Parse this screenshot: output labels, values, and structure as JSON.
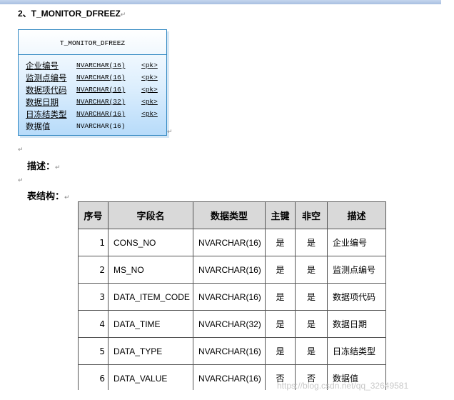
{
  "heading": "2、T_MONITOR_DFREEZ",
  "para_mark": "↵",
  "entity": {
    "title": "T_MONITOR_DFREEZ",
    "columns": [
      {
        "name": "企业编号",
        "type": "NVARCHAR(16)",
        "key": "<pk>"
      },
      {
        "name": "监测点编号",
        "type": "NVARCHAR(16)",
        "key": "<pk>"
      },
      {
        "name": "数据项代码",
        "type": "NVARCHAR(16)",
        "key": "<pk>"
      },
      {
        "name": "数据日期",
        "type": "NVARCHAR(32)",
        "key": "<pk>"
      },
      {
        "name": "日冻结类型",
        "type": "NVARCHAR(16)",
        "key": "<pk>"
      },
      {
        "name": "数据值",
        "type": "NVARCHAR(16)",
        "key": ""
      }
    ]
  },
  "desc_label": "描述：",
  "struct_label": "表结构：",
  "table": {
    "headers": [
      "序号",
      "字段名",
      "数据类型",
      "主键",
      "非空",
      "描述"
    ],
    "rows": [
      [
        "1",
        "CONS_NO",
        "NVARCHAR(16)",
        "是",
        "是",
        "企业编号"
      ],
      [
        "2",
        "MS_NO",
        "NVARCHAR(16)",
        "是",
        "是",
        "监测点编号"
      ],
      [
        "3",
        "DATA_ITEM_CODE",
        "NVARCHAR(16)",
        "是",
        "是",
        "数据项代码"
      ],
      [
        "4",
        "DATA_TIME",
        "NVARCHAR(32)",
        "是",
        "是",
        "数据日期"
      ],
      [
        "5",
        "DATA_TYPE",
        "NVARCHAR(16)",
        "是",
        "是",
        "日冻结类型"
      ],
      [
        "6",
        "DATA_VALUE",
        "NVARCHAR(16)",
        "否",
        "否",
        "数据值"
      ]
    ]
  },
  "watermark": "https://blog.csdn.net/qq_32649581"
}
